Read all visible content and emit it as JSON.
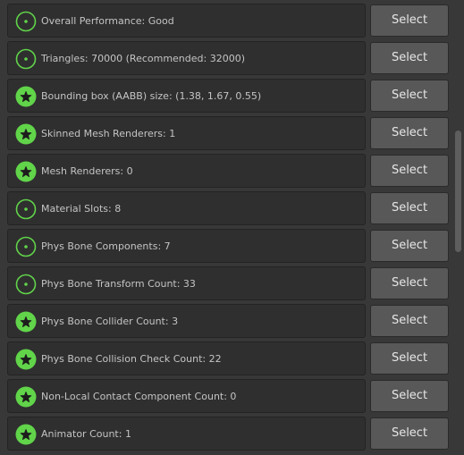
{
  "select_label": "Select",
  "colors": {
    "background": "#383838",
    "row_background": "#2f2f2f",
    "button_background": "#585858",
    "icon_green": "#61d44a",
    "text": "#c4c4c4"
  },
  "rows": [
    {
      "label": "Overall Performance: Good",
      "icon": "good-icon"
    },
    {
      "label": "Triangles: 70000 (Recommended: 32000)",
      "icon": "good-icon"
    },
    {
      "label": "Bounding box (AABB) size: (1.38, 1.67, 0.55)",
      "icon": "excellent-star-icon"
    },
    {
      "label": "Skinned Mesh Renderers: 1",
      "icon": "excellent-star-icon"
    },
    {
      "label": "Mesh Renderers: 0",
      "icon": "excellent-star-icon"
    },
    {
      "label": "Material Slots: 8",
      "icon": "good-icon"
    },
    {
      "label": "Phys Bone Components: 7",
      "icon": "good-icon"
    },
    {
      "label": "Phys Bone Transform Count: 33",
      "icon": "good-icon"
    },
    {
      "label": "Phys Bone Collider Count: 3",
      "icon": "excellent-star-icon"
    },
    {
      "label": "Phys Bone Collision Check Count: 22",
      "icon": "excellent-star-icon"
    },
    {
      "label": "Non-Local Contact Component Count: 0",
      "icon": "excellent-star-icon"
    },
    {
      "label": "Animator Count: 1",
      "icon": "excellent-star-icon"
    }
  ]
}
